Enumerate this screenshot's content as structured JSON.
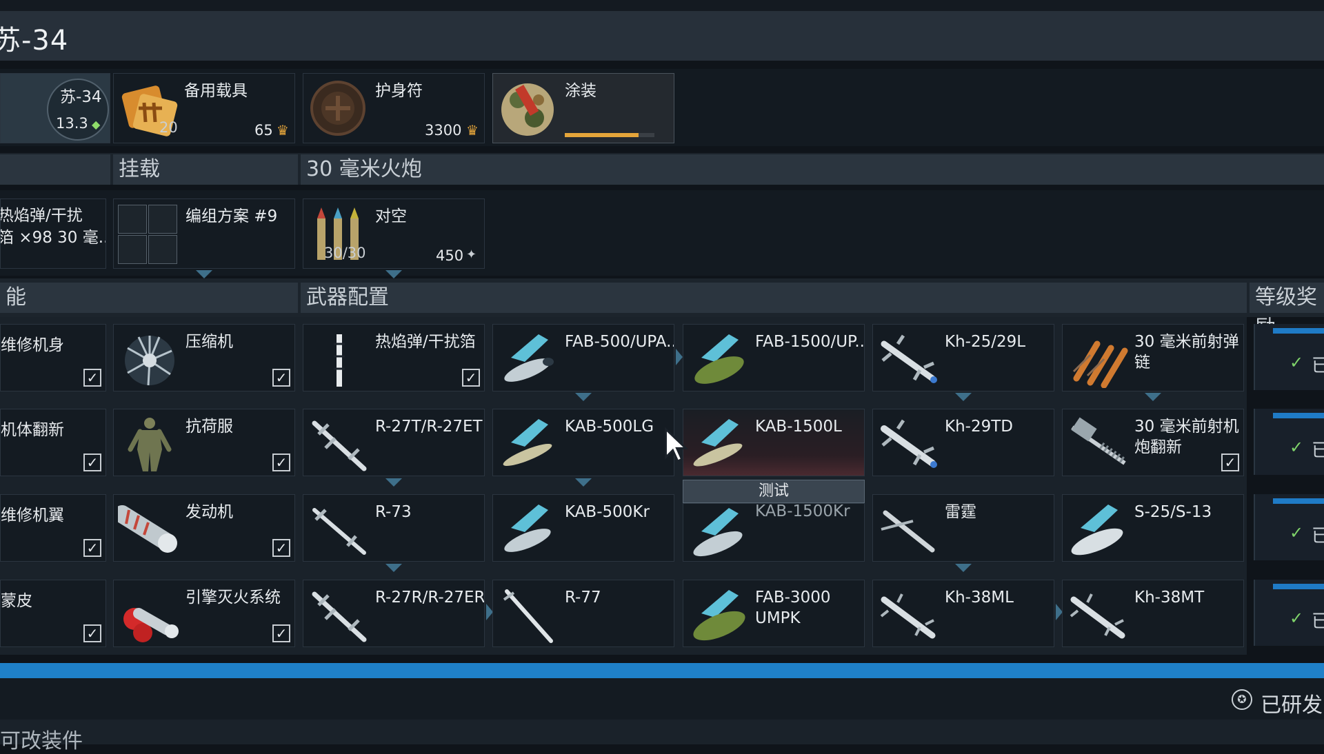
{
  "header": {
    "title": "苏-34"
  },
  "vehicle": {
    "name": "苏-34",
    "br": "13.3"
  },
  "top_cards": [
    {
      "label": "备用载具",
      "count": "20",
      "price": "65"
    },
    {
      "label": "护身符",
      "price": "3300"
    },
    {
      "label": "涂装",
      "progress": 0.82
    }
  ],
  "sections": {
    "loadout": "挂载",
    "cannon": "30 毫米火炮",
    "performance_partial": "能",
    "weapons": "武器配置",
    "rank_rewards": "等级奖励"
  },
  "loadout_row": {
    "left_partial": "热焰弹/干扰\n箔 ×98 30 毫...",
    "preset": "编组方案 #9",
    "ammo": {
      "name": "对空",
      "count": "30/30",
      "price": "450"
    }
  },
  "mods": {
    "left_partial": [
      "维修机身",
      "机体翻新",
      "维修机翼",
      "蒙皮"
    ],
    "col2": [
      "压缩机",
      "抗荷服",
      "发动机",
      "引擎灭火系统"
    ]
  },
  "weapons": {
    "rows": [
      [
        "热焰弹/干扰箔",
        "FAB-500/UPA...",
        "FAB-1500/UP...",
        "Kh-25/29L",
        "30 毫米前射弹链"
      ],
      [
        "R-27T/R-27ET",
        "KAB-500LG",
        "KAB-1500L",
        "Kh-29TD",
        "30 毫米前射机炮翻新"
      ],
      [
        "R-73",
        "KAB-500Kr",
        "KAB-1500Kr",
        "雷霆",
        "S-25/S-13"
      ],
      [
        "R-27R/R-27ER",
        "R-77",
        "FAB-3000 UMPK",
        "Kh-38ML",
        "Kh-38MT"
      ]
    ],
    "test_button": "测试"
  },
  "rank_partial": "已",
  "footer": {
    "researched": "已研发",
    "bottom_partial": "可改装件"
  },
  "colors": {
    "accent": "#1f80c8",
    "gold": "#e5a53a",
    "check": "#7fd36a"
  }
}
